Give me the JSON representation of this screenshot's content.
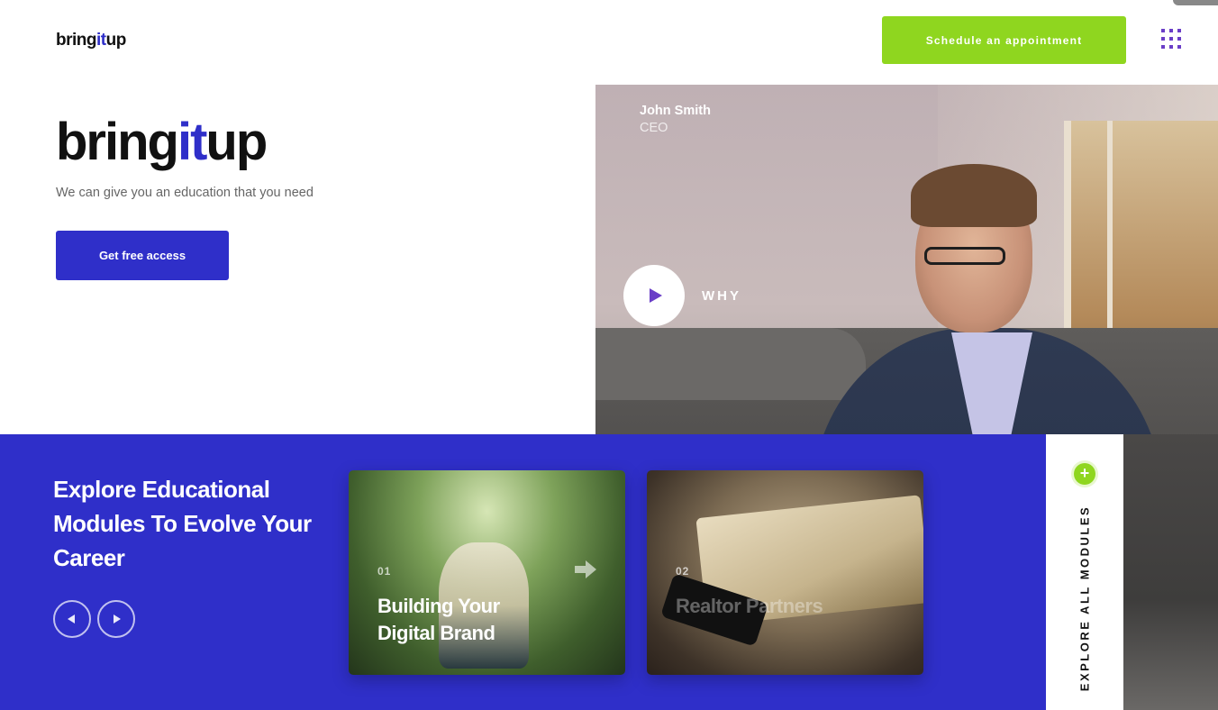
{
  "header": {
    "logo": {
      "prefix": "bring",
      "highlight": "it",
      "suffix": "up"
    },
    "cta_label": "Schedule an appointment",
    "menu_icon": "grid-dots-icon"
  },
  "hero": {
    "logo": {
      "prefix": "bring",
      "highlight": "it",
      "suffix": "up"
    },
    "subtitle": "We can give you an education that you need",
    "button_label": "Get free access"
  },
  "video": {
    "person_name": "John Smith",
    "person_role": "CEO",
    "play_icon": "play-icon",
    "label": "WHY"
  },
  "modules": {
    "title": "Explore Educational Modules To Evolve Your Career",
    "prev_icon": "arrow-left-icon",
    "next_icon": "arrow-right-icon",
    "cards": [
      {
        "number": "01",
        "title": "Building Your Digital Brand",
        "arrow_icon": "arrow-right-icon"
      },
      {
        "number": "02",
        "title": "Realtor Partners"
      }
    ],
    "explore_label": "EXPLORE ALL MODULES",
    "explore_icon": "plus-icon"
  },
  "colors": {
    "brand_blue": "#2f2fc9",
    "accent_green": "#8fd61f",
    "accent_purple": "#6a3ec7"
  }
}
